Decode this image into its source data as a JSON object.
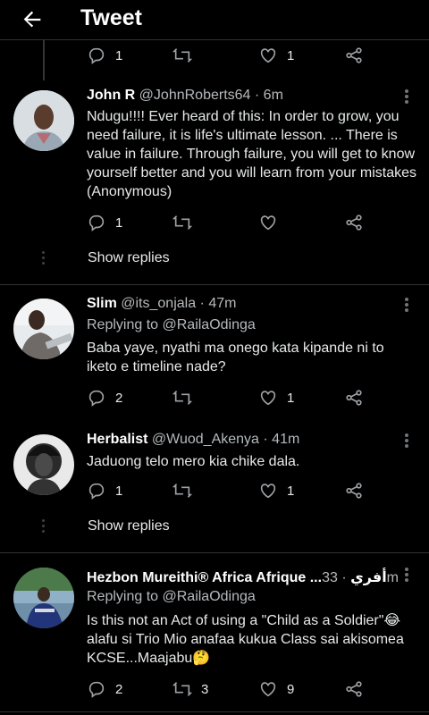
{
  "header": {
    "title": "Tweet"
  },
  "top_actions": {
    "replies": "1",
    "likes": "1"
  },
  "tweets": [
    {
      "name": "John R",
      "handle": "@JohnRoberts64",
      "time": "6m",
      "text": "Ndugu!!!! Ever heard of this: In order to grow, you need failure, it is life's ultimate lesson. ... There is value in failure. Through failure, you will get to know yourself better and you will learn from your mistakes (Anonymous)",
      "replies": "1",
      "retweets": "",
      "likes": ""
    },
    {
      "name": "Slim",
      "handle": "@its_onjala",
      "time": "47m",
      "reply_label": "Replying to",
      "reply_to": "@RailaOdinga",
      "text": "Baba yaye, nyathi ma onego kata kipande ni to iketo e timeline nade?",
      "replies": "2",
      "retweets": "",
      "likes": "1"
    },
    {
      "name": "Herbalist",
      "handle": "@Wuod_Akenya",
      "time": "41m",
      "text": "Jaduong telo mero kia chike dala.",
      "replies": "1",
      "retweets": "",
      "likes": "1"
    },
    {
      "name": "Hezbon Mureithi® Africa Afrique ...أفري",
      "handle": "",
      "time": "33m",
      "reply_label": "Replying to",
      "reply_to": "@RailaOdinga",
      "text": "Is this not an Act of using a \"Child as a Soldier\"😂 alafu si Trio Mio anafaa kukua Class sai akisomea KCSE...Maajabu🤔",
      "replies": "2",
      "retweets": "3",
      "likes": "9"
    }
  ],
  "show_replies_label": "Show replies",
  "separator": "·"
}
